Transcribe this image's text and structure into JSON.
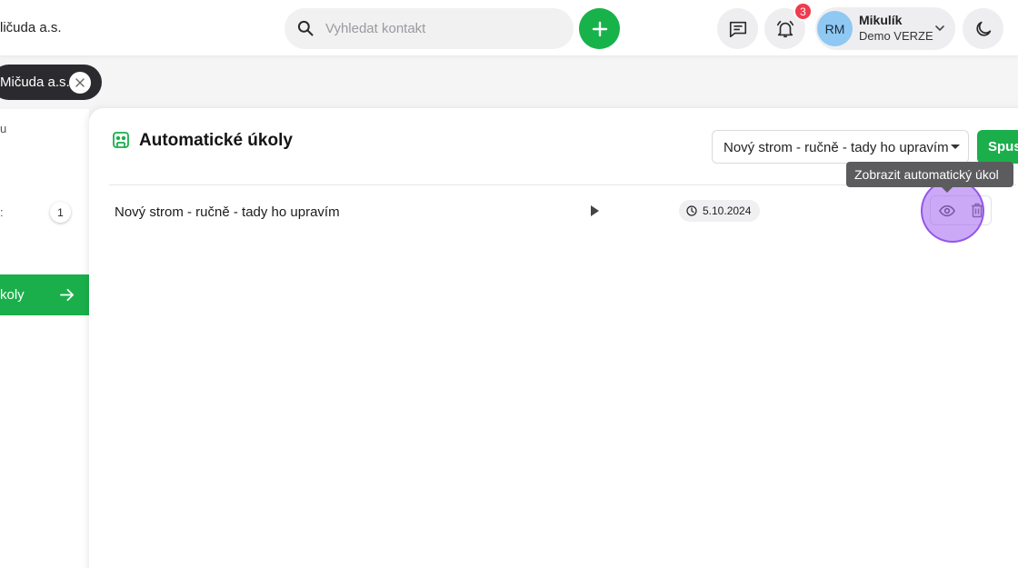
{
  "header": {
    "company": "ličuda a.s.",
    "search": {
      "placeholder": "Vyhledat kontakt"
    },
    "notifications_count": "3",
    "user": {
      "initials": "RM",
      "name": "Mikulík",
      "org": "Demo VERZE"
    }
  },
  "filter_chip": {
    "label": "Mičuda a.s."
  },
  "sidebar": {
    "top_text": "u",
    "row_mark": ":",
    "row_count": "1",
    "active_item": "koly"
  },
  "main": {
    "title": "Automatické úkoly",
    "select_value": "Nový strom - ručně - tady ho upravím",
    "run_label": "Spus",
    "rows": [
      {
        "name": "Nový strom - ručně - tady ho upravím",
        "date": "5.10.2024"
      }
    ],
    "tooltip": "Zobrazit automatický úkol"
  },
  "colors": {
    "accent": "#1aaf4b",
    "badge": "#ef3b4e",
    "highlight": "#a162f0"
  }
}
